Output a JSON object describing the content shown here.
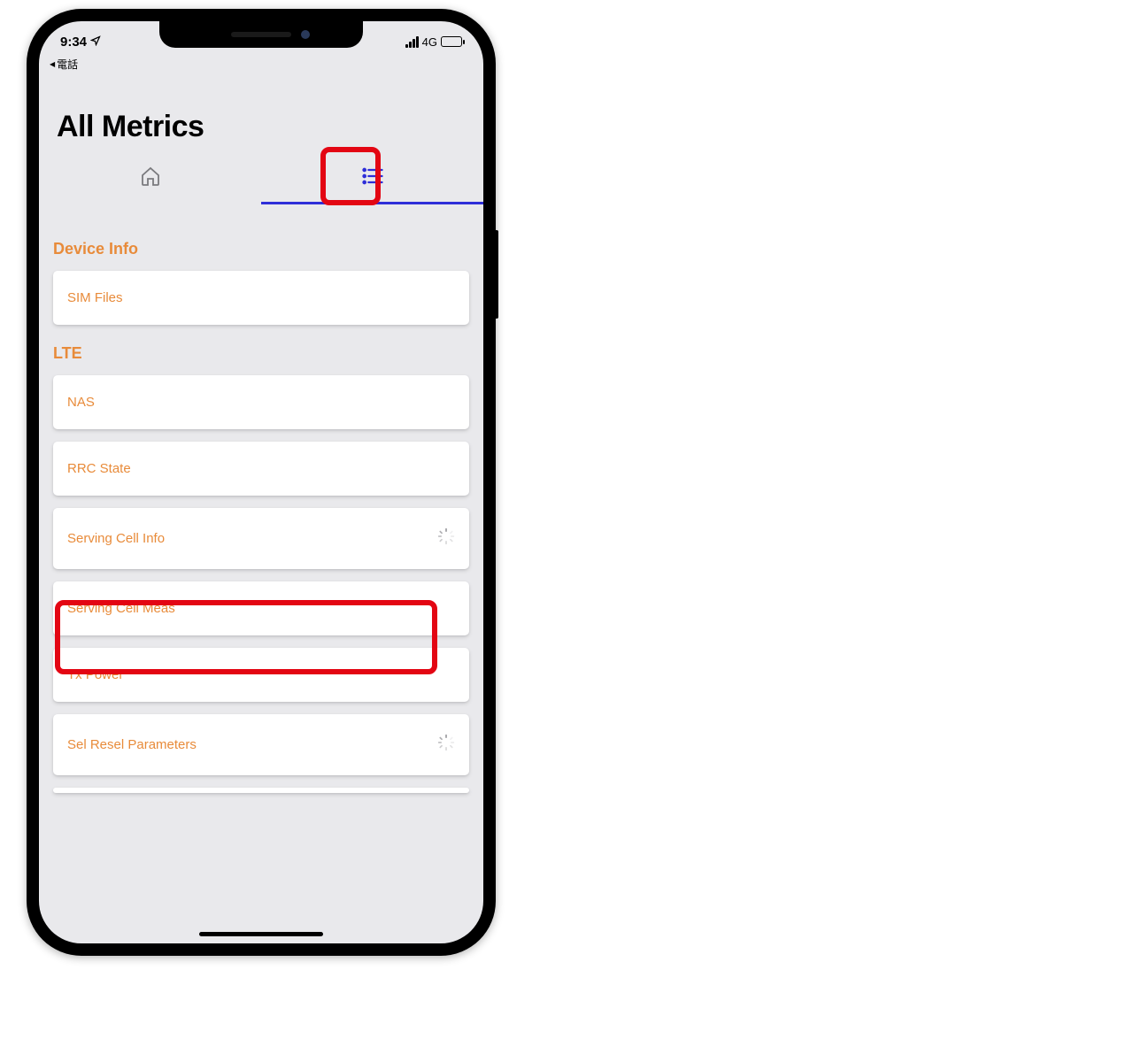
{
  "status_bar": {
    "time": "9:34",
    "back_app": "電話",
    "network_type": "4G"
  },
  "header": {
    "title": "All Metrics"
  },
  "tabs": {
    "home": {
      "icon": "home-icon"
    },
    "list": {
      "icon": "list-icon",
      "active": true
    }
  },
  "sections": [
    {
      "title": "Device Info",
      "items": [
        {
          "label": "SIM Files",
          "loading": false
        }
      ]
    },
    {
      "title": "LTE",
      "items": [
        {
          "label": "NAS",
          "loading": false
        },
        {
          "label": "RRC State",
          "loading": false
        },
        {
          "label": "Serving Cell Info",
          "loading": true
        },
        {
          "label": "Serving Cell Meas",
          "loading": false
        },
        {
          "label": "Tx Power",
          "loading": false
        },
        {
          "label": "Sel Resel Parameters",
          "loading": true
        }
      ]
    }
  ],
  "colors": {
    "accent": "#e88b3a",
    "tab_indicator": "#2e2ed8",
    "highlight": "#e30613"
  }
}
